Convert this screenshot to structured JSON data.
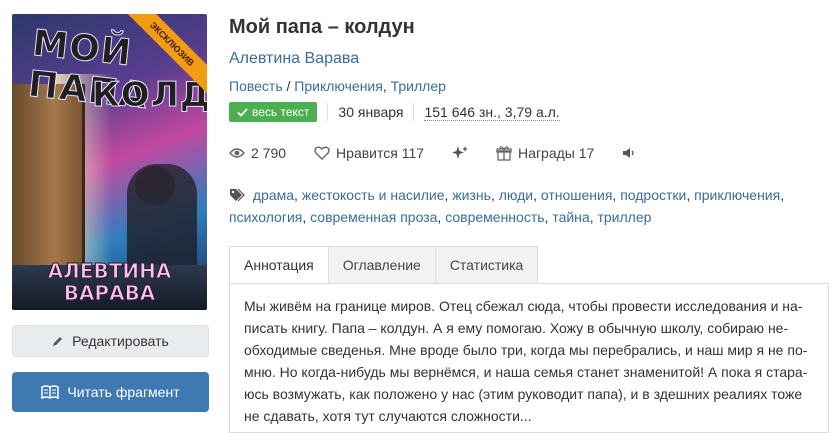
{
  "cover": {
    "ribbon": "ЭКСКЛЮЗИВ",
    "title_line1": "МОЙ ПАПА",
    "title_line2": "КОЛДУН",
    "author_line1": "АЛЕВТИНА",
    "author_line2": "ВАРАВА"
  },
  "book": {
    "title": "Мой папа – колдун",
    "author": "Алевтина Варава",
    "form": "Повесть",
    "genre_sep": " / ",
    "genre1": "Приключения",
    "genre_comma": ", ",
    "genre2": "Триллер"
  },
  "meta": {
    "status": "весь текст",
    "date": "30 января",
    "size": "151 646 зн., 3,79 а.л."
  },
  "stats": {
    "views": "2 790",
    "likes": "Нравится 117",
    "awards": "Награды 17"
  },
  "tags": [
    "драма",
    "жестокость и насилие",
    "жизнь",
    "люди",
    "отношения",
    "подростки",
    "приключения",
    "психология",
    "современная проза",
    "современность",
    "тайна",
    "триллер"
  ],
  "buttons": {
    "edit": "Редактировать",
    "read": "Читать фрагмент"
  },
  "tabs": [
    "Аннотация",
    "Оглавление",
    "Статистика"
  ],
  "annotation": "Мы живём на границе миров. Отец сбежал сюда, чтобы провести исследования и на­писать книгу. Папа – колдун. А я ему помогаю. Хожу в обычную школу, собираю не­обходимые сведенья. Мне вроде было три, когда мы перебрались, и наш мир я не по­мню. Но когда-нибудь мы вернёмся, и наша семья станет знаменитой! А пока я стара­юсь возмужать, как положено у нас (этим руководит папа), и в здешних реалиях тоже не сдавать, хотя тут случаются сложности...",
  "colors": {
    "link": "#3a6d99",
    "badge": "#4caf50",
    "read_button": "#3f79b1",
    "ribbon": "#f39c12"
  }
}
